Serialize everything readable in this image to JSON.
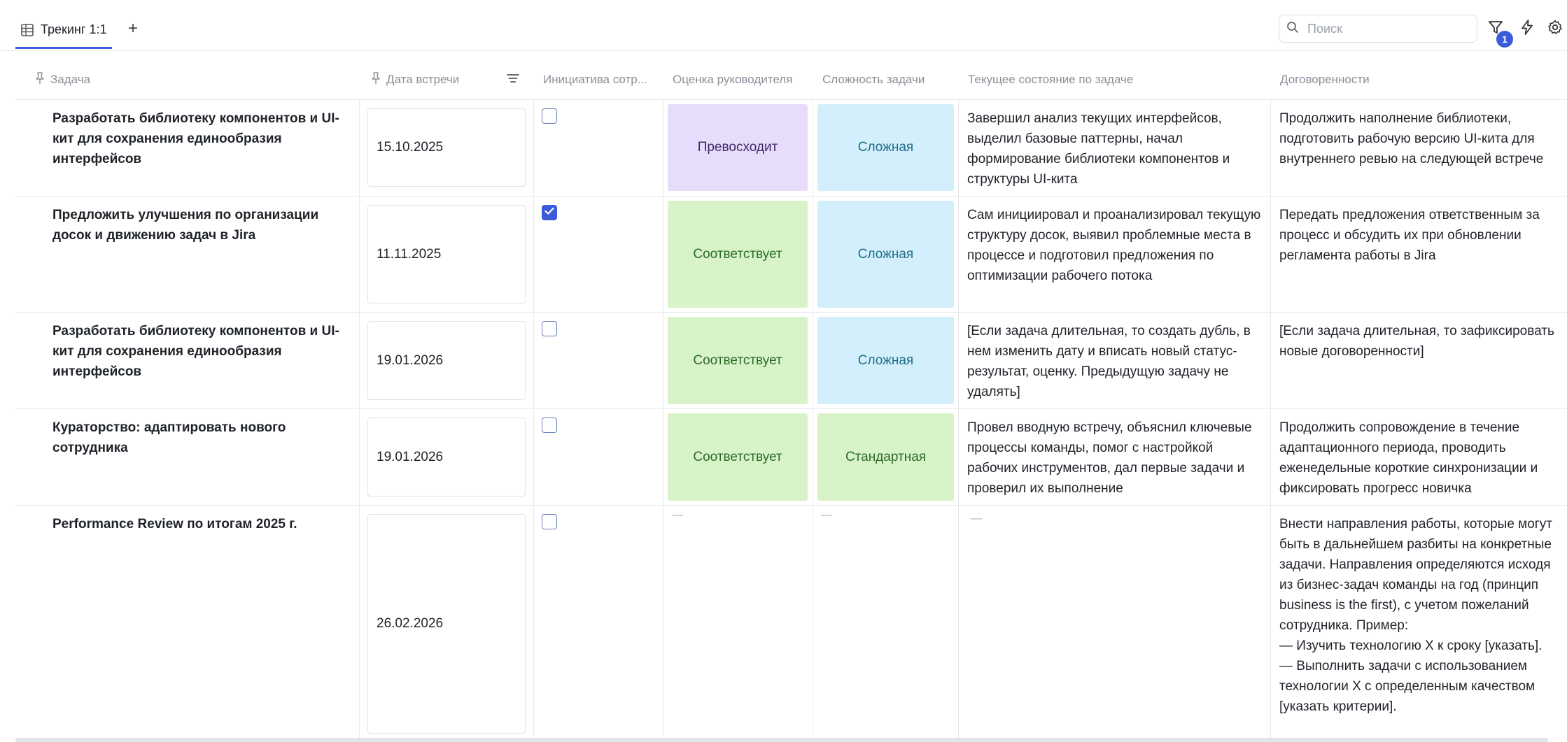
{
  "tab": {
    "label": "Трекинг 1:1",
    "icon": "table-icon"
  },
  "add_tab": "+",
  "search": {
    "placeholder": "Поиск"
  },
  "toolbar": {
    "filter_badge": "1"
  },
  "columns": [
    "Задача",
    "Дата встречи",
    "Инициатива сотр...",
    "Оценка руководителя",
    "Сложность задачи",
    "Текущее состояние по задаче",
    "Договоренности"
  ],
  "rows": [
    {
      "task": "Разработать библиотеку компонентов и UI-кит для сохранения единообразия интерфейсов",
      "date": "15.10.2025",
      "initiative": false,
      "rating": "Превосходит",
      "rating_color": "#e8dcfb",
      "complexity": "Сложная",
      "complexity_color": "#d3effb",
      "status": "Завершил анализ текущих интерфейсов, выделил базовые паттерны, начал формирование библиотеки компонентов и структуры UI-кита",
      "agreements": "Продолжить наполнение библиотеки, подготовить рабочую версию UI-кита для внутреннего ревью на следующей встрече"
    },
    {
      "task": "Предложить улучшения по организации досок и движению задач в Jira",
      "date": "11.11.2025",
      "initiative": true,
      "rating": "Соответствует",
      "rating_color": "#d8f3c7",
      "complexity": "Сложная",
      "complexity_color": "#d3effb",
      "status": "Сам инициировал и проанализировал текущую структуру досок, выявил проблемные места в процессе и подготовил предложения по оптимизации рабочего потока",
      "agreements": "Передать предложения ответственным за процесс и обсудить их при обновлении регламента работы в Jira"
    },
    {
      "task": "Разработать библиотеку компонентов и UI-кит для сохранения единообразия интерфейсов",
      "date": "19.01.2026",
      "initiative": false,
      "rating": "Соответствует",
      "rating_color": "#d8f3c7",
      "complexity": "Сложная",
      "complexity_color": "#d3effb",
      "status": "[Если задача длительная, то создать дубль, в нем изменить дату и вписать новый статус-результат, оценку. Предыдущую задачу не удалять]",
      "agreements": "[Если задача длительная, то зафиксировать новые договоренности]"
    },
    {
      "task": "Кураторство: адаптировать нового сотрудника",
      "date": "19.01.2026",
      "initiative": false,
      "rating": "Соответствует",
      "rating_color": "#d8f3c7",
      "complexity": "Стандартная",
      "complexity_color": "#d8f3c7",
      "status": "Провел вводную встречу, объяснил ключевые процессы команды, помог с настройкой рабочих инструментов, дал первые задачи и проверил их выполнение",
      "agreements": "Продолжить сопровождение в течение адаптационного периода, проводить еженедельные короткие синхронизации и фиксировать прогресс новичка"
    },
    {
      "task": "Performance Review по итогам 2025 г.",
      "date": "26.02.2026",
      "initiative": false,
      "rating": "—",
      "complexity": "—",
      "status": "—",
      "agreements": "Внести направления работы, которые могут быть в дальнейшем разбиты на конкретные задачи. Направления определяются исходя из бизнес-задач команды на год (принцип business is the first), с учетом пожеланий сотрудника. Пример:\n— Изучить технологию X к сроку [указать].\n— Выполнить задачи с использованием технологии X с определенным качеством [указать критерии]."
    }
  ]
}
